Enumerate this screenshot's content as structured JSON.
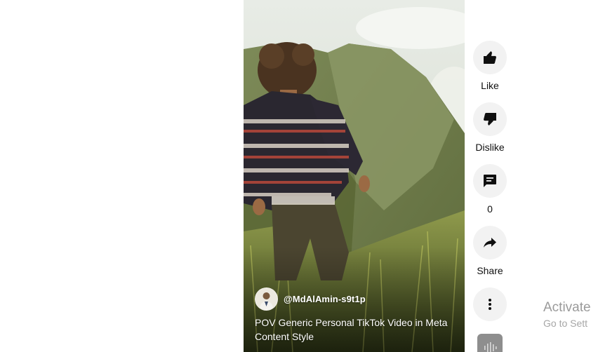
{
  "video": {
    "channel_handle": "@MdAlAmin-s9t1p",
    "title": "POV Generic Personal TikTok Video in Meta Content Style"
  },
  "actions": {
    "like_label": "Like",
    "dislike_label": "Dislike",
    "comment_count": "0",
    "share_label": "Share"
  },
  "watermark": {
    "title": "Activate",
    "subtitle": "Go to Sett"
  }
}
